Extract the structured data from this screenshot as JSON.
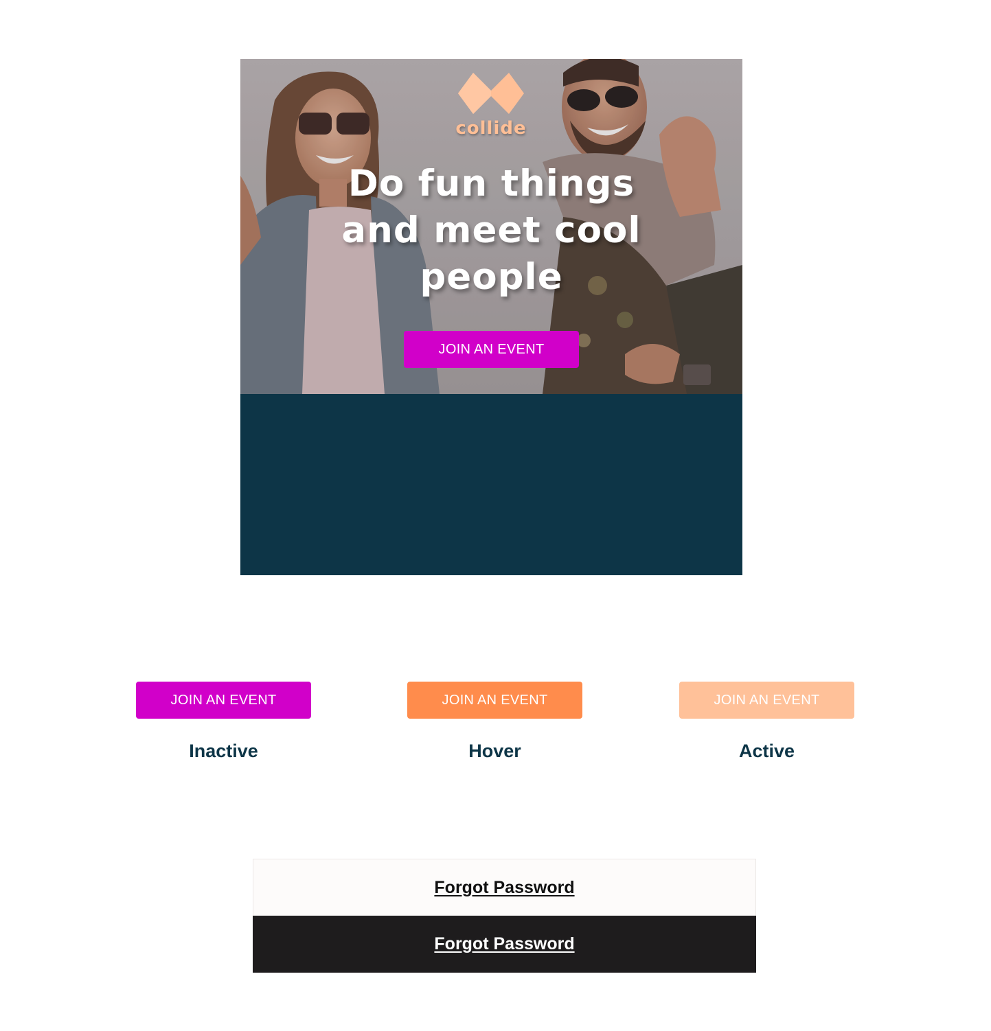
{
  "hero": {
    "logo_text": "collide",
    "headline": "Do fun things and meet cool people",
    "cta_label": "JOIN AN EVENT"
  },
  "states": [
    {
      "button_label": "JOIN AN EVENT",
      "state_label": "Inactive",
      "color": "#d100c9"
    },
    {
      "button_label": "JOIN AN EVENT",
      "state_label": "Hover",
      "color": "#ff8c4c"
    },
    {
      "button_label": "JOIN AN EVENT",
      "state_label": "Active",
      "color": "#ffc199"
    }
  ],
  "forgot_password": {
    "light_label": "Forgot Password",
    "dark_label": "Forgot Password"
  },
  "colors": {
    "brand_magenta": "#d100c9",
    "brand_orange": "#ff8c4c",
    "brand_peach": "#ffc199",
    "navy": "#0d3547",
    "dark_bar": "#1e1c1d",
    "light_bar": "#fdfbfa"
  }
}
